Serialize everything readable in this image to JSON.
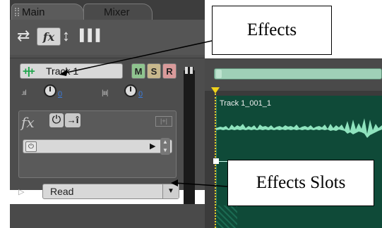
{
  "tabs": [
    {
      "label": "Main",
      "active": true
    },
    {
      "label": "Mixer",
      "active": false
    }
  ],
  "toolbar": {
    "icons": [
      "swap-arrows-icon",
      "fx-icon",
      "updown-arrows-icon",
      "level-bars-icon"
    ],
    "fx_label": "fx"
  },
  "track": {
    "name": "Track 1",
    "mute_label": "M",
    "solo_label": "S",
    "record_label": "R",
    "volume_value": "0",
    "pan_value": "0"
  },
  "fx_rack": {
    "label": "fx",
    "power_glyph": "⏻",
    "add_glyph": "→î",
    "slot_power_glyph": "⏻"
  },
  "automation": {
    "mode": "Read"
  },
  "clip": {
    "title": "Track 1_001_1"
  },
  "callouts": {
    "effects": "Effects",
    "effects_slots": "Effects Slots"
  },
  "colors": {
    "panel": "#4f4f4f",
    "clip_bg": "#0f4a38",
    "waveform": "#8fe3be",
    "scrollbar": "#9fd0b7",
    "playhead": "#f0d21a"
  }
}
